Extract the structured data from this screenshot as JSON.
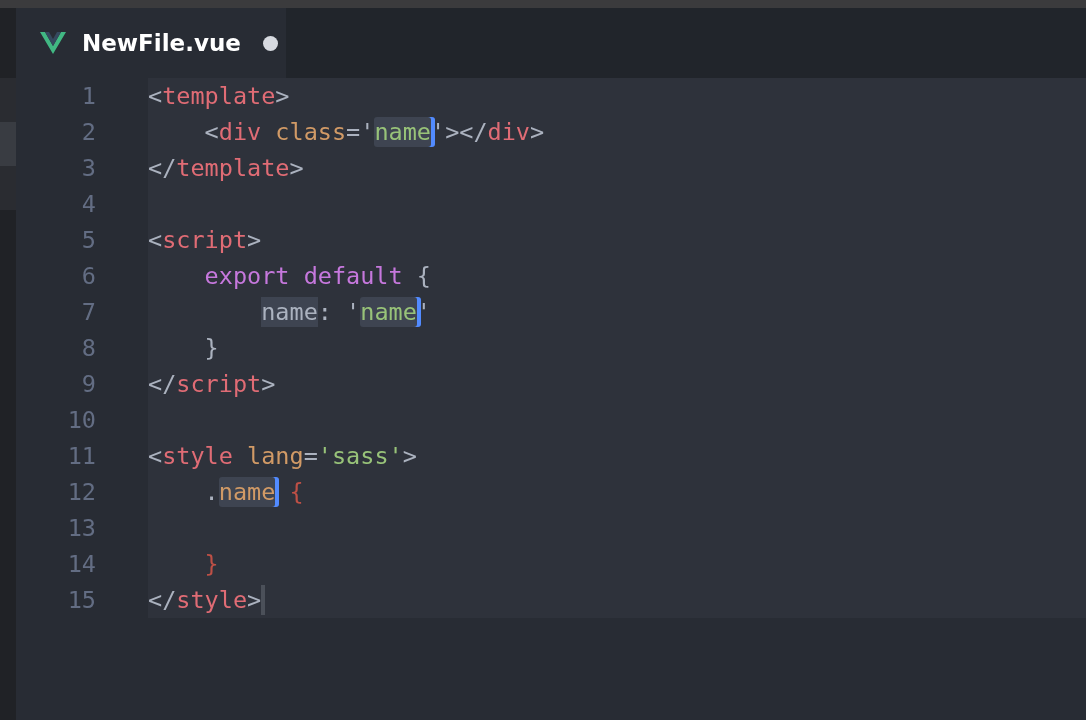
{
  "tab": {
    "title": "NewFile.vue",
    "selected": true,
    "modified": true
  },
  "lines": [
    {
      "number": "1",
      "tokens": [
        {
          "kind": "punct",
          "text": "<"
        },
        {
          "kind": "tag",
          "text": "template"
        },
        {
          "kind": "punct",
          "text": ">"
        }
      ]
    },
    {
      "number": "2",
      "tokens": [
        {
          "kind": "punct",
          "text": "    <"
        },
        {
          "kind": "tag",
          "text": "div"
        },
        {
          "kind": "attr",
          "text": " class"
        },
        {
          "kind": "punct",
          "text": "='"
        },
        {
          "kind": "string",
          "text": "name",
          "highlighted": true,
          "cursor": true,
          "cursor_focused": true
        },
        {
          "kind": "punct",
          "text": "'></"
        },
        {
          "kind": "tag",
          "text": "div"
        },
        {
          "kind": "punct",
          "text": ">"
        }
      ]
    },
    {
      "number": "3",
      "tokens": [
        {
          "kind": "punct",
          "text": "</"
        },
        {
          "kind": "tag",
          "text": "template"
        },
        {
          "kind": "punct",
          "text": ">"
        }
      ]
    },
    {
      "number": "4"
    },
    {
      "number": "5",
      "tokens": [
        {
          "kind": "punct",
          "text": "<"
        },
        {
          "kind": "tag",
          "text": "script"
        },
        {
          "kind": "punct",
          "text": ">"
        }
      ]
    },
    {
      "number": "6",
      "tokens": [
        {
          "kind": "keyword",
          "text": "    export default"
        },
        {
          "kind": "punct",
          "text": " {"
        }
      ]
    },
    {
      "number": "7",
      "tokens": [
        {
          "kind": "plain",
          "text": "        name",
          "highlighted": true
        },
        {
          "kind": "punct",
          "text": ": '"
        },
        {
          "kind": "string",
          "text": "name",
          "highlighted": true,
          "cursor": true,
          "cursor_focused": true
        },
        {
          "kind": "punct",
          "text": "'"
        }
      ]
    },
    {
      "number": "8",
      "tokens": [
        {
          "kind": "punct",
          "text": "    }"
        }
      ]
    },
    {
      "number": "9",
      "tokens": [
        {
          "kind": "punct",
          "text": "</"
        },
        {
          "kind": "tag",
          "text": "script"
        },
        {
          "kind": "punct",
          "text": ">"
        }
      ]
    },
    {
      "number": "10"
    },
    {
      "number": "11",
      "tokens": [
        {
          "kind": "punct",
          "text": "<"
        },
        {
          "kind": "tag",
          "text": "style"
        },
        {
          "kind": "attr",
          "text": " lang"
        },
        {
          "kind": "punct",
          "text": "="
        },
        {
          "kind": "string",
          "text": "'sass'"
        },
        {
          "kind": "punct",
          "text": ">"
        }
      ]
    },
    {
      "number": "12",
      "tokens": [
        {
          "kind": "punct",
          "text": "    ."
        },
        {
          "kind": "attr",
          "text": "name",
          "highlighted": true,
          "cursor": true,
          "cursor_focused": true
        },
        {
          "kind": "brace",
          "text": " {"
        }
      ]
    },
    {
      "number": "13"
    },
    {
      "number": "14",
      "tokens": [
        {
          "kind": "brace",
          "text": "    }"
        }
      ]
    },
    {
      "number": "15",
      "tokens": [
        {
          "kind": "punct",
          "text": "</"
        },
        {
          "kind": "tag",
          "text": "style"
        },
        {
          "kind": "punct",
          "text": ">",
          "cursor": true,
          "cursor_focused": false
        }
      ]
    }
  ]
}
